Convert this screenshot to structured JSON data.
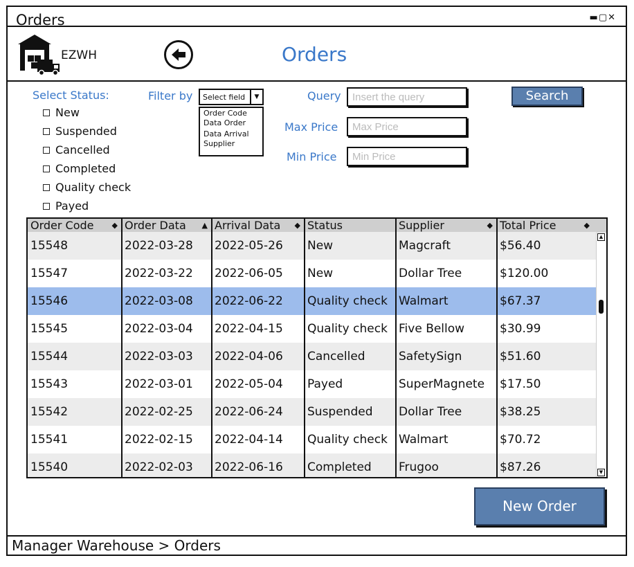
{
  "window": {
    "title": "Orders",
    "controls": "▬▢✕"
  },
  "header": {
    "logo_text": "EZWH",
    "page_title": "Orders"
  },
  "filters": {
    "select_status_label": "Select Status:",
    "statuses": [
      "New",
      "Suspended",
      "Cancelled",
      "Completed",
      "Quality check",
      "Payed"
    ],
    "filter_by_label": "Filter by",
    "filter_select_value": "Select field",
    "filter_options": [
      "Order Code",
      "Data Order",
      "Data Arrival",
      "Supplier"
    ],
    "query_label": "Query",
    "query_placeholder": "Insert the query",
    "max_price_label": "Max Price",
    "max_price_placeholder": "Max Price",
    "min_price_label": "Min Price",
    "min_price_placeholder": "Min Price",
    "search_label": "Search"
  },
  "table": {
    "columns": [
      "Order Code",
      "Order Data",
      "Arrival Data",
      "Status",
      "Supplier",
      "Total Price"
    ],
    "selected_row": 2,
    "rows": [
      [
        "15548",
        "2022-03-28",
        "2022-05-26",
        "New",
        "Magcraft",
        "$56.40"
      ],
      [
        "15547",
        "2022-03-22",
        "2022-06-05",
        "New",
        "Dollar Tree",
        "$120.00"
      ],
      [
        "15546",
        "2022-03-08",
        "2022-06-22",
        "Quality check",
        "Walmart",
        "$67.37"
      ],
      [
        "15545",
        "2022-03-04",
        "2022-04-15",
        "Quality check",
        "Five Bellow",
        "$30.99"
      ],
      [
        "15544",
        "2022-03-03",
        "2022-04-06",
        "Cancelled",
        "SafetySign",
        "$51.60"
      ],
      [
        "15543",
        "2022-03-01",
        "2022-05-04",
        "Payed",
        "SuperMagnete",
        "$17.50"
      ],
      [
        "15542",
        "2022-02-25",
        "2022-06-24",
        "Suspended",
        "Dollar Tree",
        "$38.25"
      ],
      [
        "15541",
        "2022-02-15",
        "2022-04-14",
        "Quality check",
        "Walmart",
        "$70.72"
      ],
      [
        "15540",
        "2022-02-03",
        "2022-06-16",
        "Completed",
        "Frugoo",
        "$87.26"
      ]
    ]
  },
  "actions": {
    "new_order_label": "New Order"
  },
  "footer": {
    "breadcrumb": "Manager Warehouse > Orders"
  },
  "colors": {
    "accent": "#3a78c9",
    "button": "#5a7fae",
    "selected_row": "#9dbcec",
    "zebra": "#ececec"
  }
}
